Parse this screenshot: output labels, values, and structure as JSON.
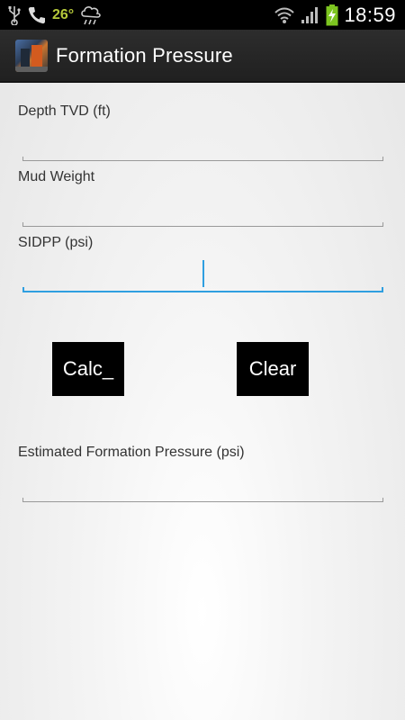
{
  "status_bar": {
    "temperature": "26°",
    "time": "18:59",
    "icons": [
      "usb-icon",
      "phone-icon",
      "cloud-rain-icon",
      "wifi-icon",
      "signal-icon",
      "battery-charging-icon"
    ]
  },
  "action_bar": {
    "title": "Formation Pressure",
    "icon": "app-icon"
  },
  "form": {
    "depth_label": "Depth TVD (ft)",
    "depth_value": "",
    "mud_weight_label": "Mud Weight",
    "mud_weight_value": "",
    "sidpp_label": "SIDPP (psi)",
    "sidpp_value": "",
    "result_label": "Estimated Formation Pressure (psi)",
    "result_value": ""
  },
  "buttons": {
    "calc_label": "Calc_",
    "clear_label": "Clear"
  },
  "colors": {
    "accent": "#2f9fe0",
    "temperature": "#b6c93a",
    "battery": "#7dc520"
  }
}
